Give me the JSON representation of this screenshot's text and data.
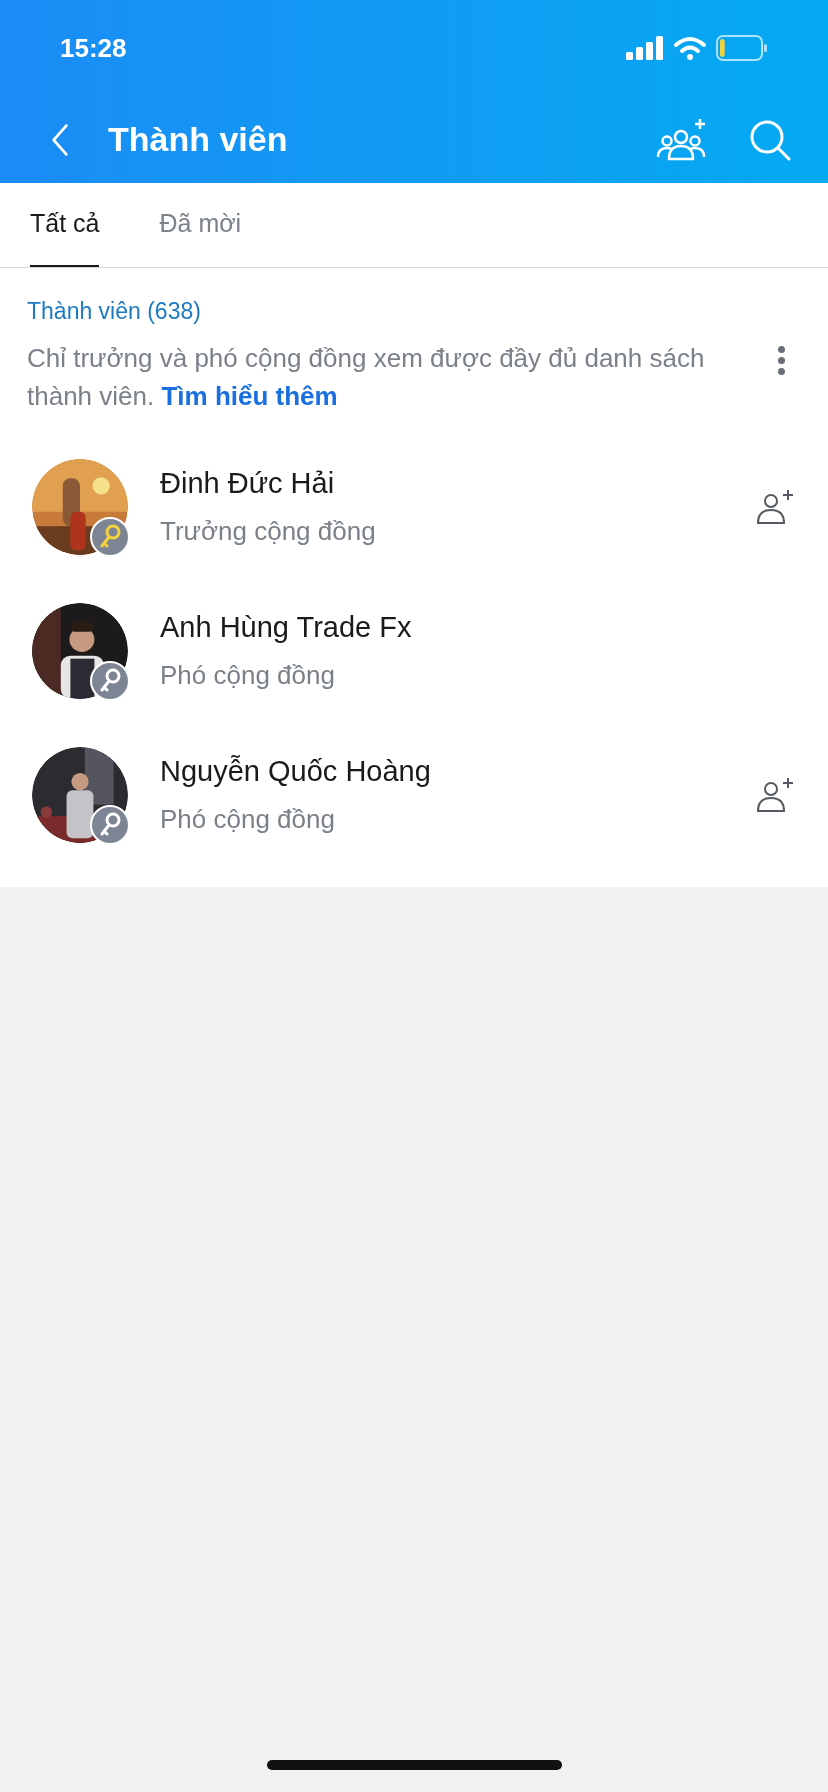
{
  "status_bar": {
    "time": "15:28"
  },
  "header": {
    "title": "Thành viên"
  },
  "tabs": [
    {
      "label": "Tất cả",
      "selected": true
    },
    {
      "label": "Đã mời",
      "selected": false
    }
  ],
  "section": {
    "title": "Thành viên (638)",
    "note": "Chỉ trưởng và phó cộng đồng xem được đầy đủ danh sách thành viên.",
    "link": "Tìm hiểu thêm"
  },
  "members": [
    {
      "name": "Đinh Đức Hải",
      "role": "Trưởng cộng đồng",
      "kind": "leader",
      "add_friend": true
    },
    {
      "name": "Anh Hùng Trade Fx",
      "role": "Phó cộng đồng",
      "kind": "deputy",
      "add_friend": false
    },
    {
      "name": "Nguyễn Quốc Hoàng",
      "role": "Phó cộng đồng",
      "kind": "deputy",
      "add_friend": true
    }
  ]
}
